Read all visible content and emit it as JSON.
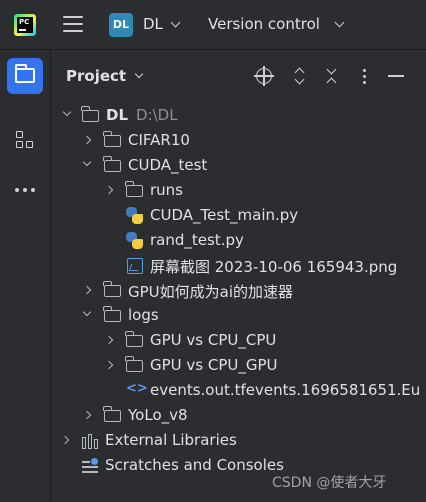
{
  "topbar": {
    "logo_text": "PC",
    "project_badge": "DL",
    "project_name": "DL",
    "vcs_label": "Version control"
  },
  "panel": {
    "title": "Project"
  },
  "tree": {
    "root": {
      "name": "DL",
      "path": "D:\\DL"
    },
    "cifar10": "CIFAR10",
    "cuda_test": "CUDA_test",
    "runs": "runs",
    "cuda_main": "CUDA_Test_main.py",
    "rand_test": "rand_test.py",
    "screenshot_png": "屏幕截图 2023-10-06 165943.png",
    "gpu_accel": "GPU如何成为ai的加速器",
    "logs": "logs",
    "gpu_vs_cpu_cpu": "GPU vs CPU_CPU",
    "gpu_vs_cpu_gpu": "GPU vs CPU_GPU",
    "events_file": "events.out.tfevents.1696581651.Eu",
    "yolo": "YoLo_v8",
    "external_libs": "External Libraries",
    "scratches": "Scratches and Consoles"
  },
  "watermark": "CSDN @使者大牙",
  "colors": {
    "background": "#2b2d30",
    "accent": "#3574f0",
    "project_badge": "#2e8ab5",
    "text": "#dfe1e5",
    "secondary_text": "#8c8f94"
  }
}
